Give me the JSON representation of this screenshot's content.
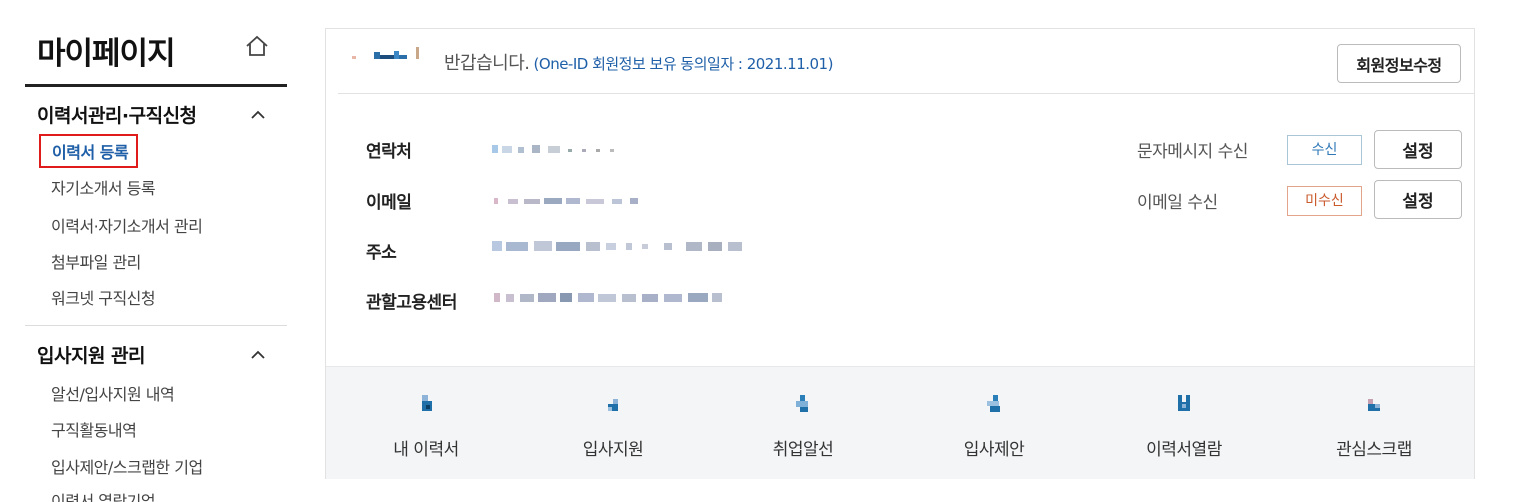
{
  "sidebar": {
    "title": "마이페이지",
    "groups": [
      {
        "title": "이력서관리·구직신청",
        "items": [
          {
            "label": "이력서 등록"
          },
          {
            "label": "자기소개서 등록"
          },
          {
            "label": "이력서·자기소개서 관리"
          },
          {
            "label": "첨부파일 관리"
          },
          {
            "label": "워크넷 구직신청"
          }
        ]
      },
      {
        "title": "입사지원 관리",
        "items": [
          {
            "label": "알선/입사지원 내역"
          },
          {
            "label": "구직활동내역"
          },
          {
            "label": "입사제안/스크랩한 기업"
          },
          {
            "label": "이력서 열람기업"
          }
        ]
      }
    ]
  },
  "profile": {
    "greeting": "반갑습니다.",
    "consent_note": "(One-ID 회원정보 보유 동의일자 : 2021.11.01)",
    "edit_button": "회원정보수정",
    "fields": [
      {
        "label": "연락처"
      },
      {
        "label": "이메일"
      },
      {
        "label": "주소"
      },
      {
        "label": "관할고용센터"
      }
    ],
    "sms": {
      "label": "문자메시지 수신",
      "status": "수신",
      "button": "설정"
    },
    "email": {
      "label": "이메일 수신",
      "status": "미수신",
      "button": "설정"
    }
  },
  "quick_links": [
    {
      "label": "내 이력서",
      "icon": "resume-icon"
    },
    {
      "label": "입사지원",
      "icon": "apply-icon"
    },
    {
      "label": "취업알선",
      "icon": "job-placement-icon"
    },
    {
      "label": "입사제안",
      "icon": "job-offer-icon"
    },
    {
      "label": "이력서열람",
      "icon": "resume-view-icon"
    },
    {
      "label": "관심스크랩",
      "icon": "scrap-icon"
    }
  ],
  "colors": {
    "active_link": "#1f5fa8",
    "highlight_border": "#e01b1b",
    "sms_on": "#2f78b7",
    "email_off": "#c95a2c"
  }
}
